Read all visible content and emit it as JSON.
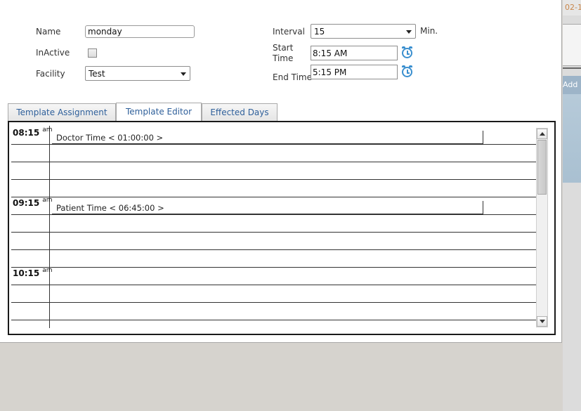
{
  "form": {
    "name_label": "Name",
    "name_value": "monday",
    "inactive_label": "InActive",
    "facility_label": "Facility",
    "facility_value": "Test",
    "interval_label": "Interval",
    "interval_value": "15",
    "interval_unit": "Min.",
    "start_time_label": "Start Time",
    "start_time_value": "8:15 AM",
    "end_time_label": "End Time",
    "end_time_value": "5:15 PM"
  },
  "tabs": [
    {
      "label": "Template Assignment",
      "active": false
    },
    {
      "label": "Template Editor",
      "active": true
    },
    {
      "label": "Effected Days",
      "active": false
    }
  ],
  "schedule": {
    "time_labels": [
      {
        "time": "08:15",
        "suffix": "am"
      },
      {
        "time": "09:15",
        "suffix": "am"
      },
      {
        "time": "10:15",
        "suffix": "am"
      }
    ],
    "appointments": [
      {
        "label": "Doctor Time < 01:00:00 >"
      },
      {
        "label": "Patient Time < 06:45:00 >"
      }
    ]
  },
  "background_window": {
    "date_fragment": "02-1",
    "add_fragment": "Add"
  },
  "colors": {
    "tab_text": "#2e5f9a",
    "clock_icon": "#3a8fcf",
    "desktop_bg": "#d6d3ce"
  }
}
